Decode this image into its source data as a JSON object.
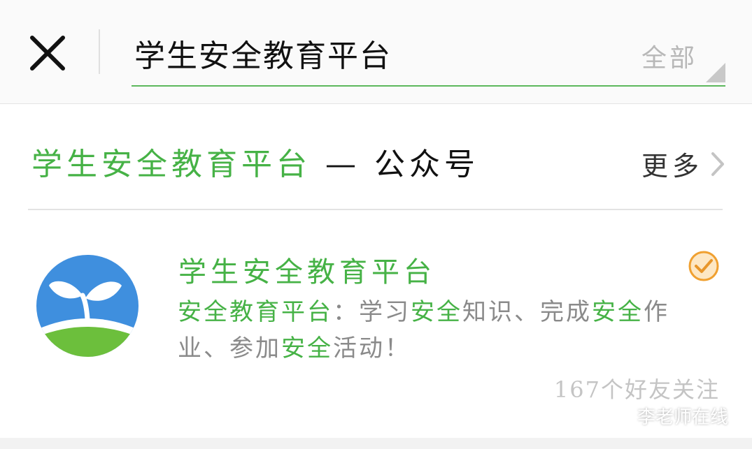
{
  "search": {
    "query": "学生安全教育平台",
    "scope_label": "全部"
  },
  "section": {
    "keyword": "学生安全教育平台",
    "separator": " — ",
    "category": "公众号",
    "more_label": "更多"
  },
  "result": {
    "name": "学生安全教育平台",
    "desc": [
      {
        "t": "安全教育平台",
        "hl": true
      },
      {
        "t": "：学习",
        "hl": false
      },
      {
        "t": "安全",
        "hl": true
      },
      {
        "t": "知识、完成",
        "hl": false
      },
      {
        "t": "安全",
        "hl": true
      },
      {
        "t": "作业、参加",
        "hl": false
      },
      {
        "t": "安全",
        "hl": true
      },
      {
        "t": "活动！",
        "hl": false
      }
    ],
    "follow_count": "167个好友关注",
    "verified": true
  },
  "watermark": {
    "text": "李老师在线"
  },
  "colors": {
    "accent_green": "#46b246",
    "verified_orange": "#f0a030",
    "avatar_blue": "#3f8fde",
    "avatar_green": "#6cbf3c"
  },
  "icons": {
    "close": "close-icon",
    "scope_dropdown": "triangle-corner-icon",
    "more": "chevron-right-icon",
    "verified": "verified-badge-icon",
    "avatar": "sprout-logo",
    "watermark": "wechat-icon"
  }
}
